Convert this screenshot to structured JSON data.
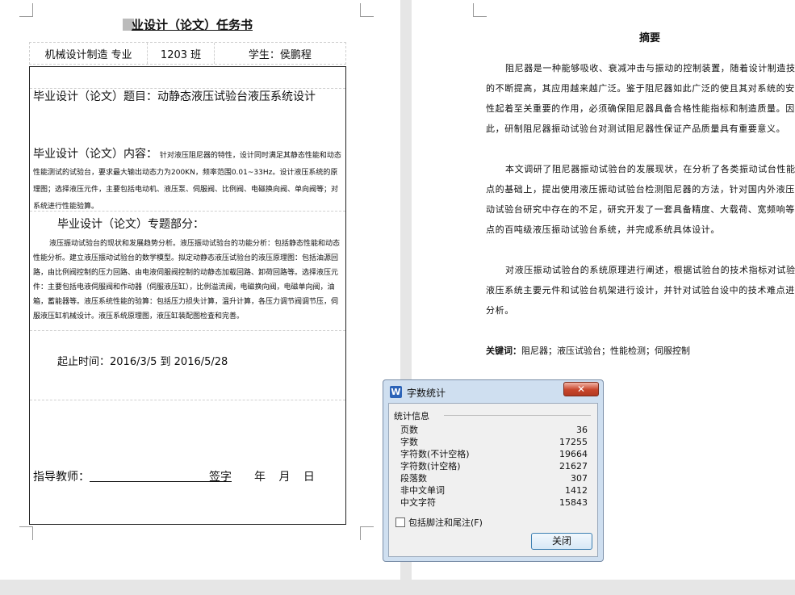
{
  "task_page": {
    "title": "业设计（论文）任务书",
    "major": "机械设计制造 专业",
    "class": "1203 班",
    "student": "学生：侯鹏程",
    "topic_label": "毕业设计（论文）题目：",
    "topic_value": "动静态液压试验台液压系统设计",
    "content_label": "毕业设计（论文）内容：",
    "content_text": "针对液压阻尼器的特性，设计同时满足其静态性能和动态性能测试的试验台，要求最大输出动态力为200KN，频率范围0.01~33Hz。设计液压系统的原理图；选择液压元件，主要包括电动机、液压泵、伺服阀、比例阀、电磁换向阀、单向阀等；对系统进行性能验算。",
    "special_label": "毕业设计（论文）专题部分：",
    "special_text": "液压振动试验台的现状和发展趋势分析。液压振动试验台的功能分析：包括静态性能和动态性能分析。建立液压振动试验台的数学模型。拟定动静态液压试验台的液压原理图：包括油源回路，由比例阀控制的压力回路、由电液伺服阀控制的动静态加载回路、卸荷回路等。选择液压元件：主要包括电液伺服阀和作动器（伺服液压缸），比例溢流阀，电磁换向阀，电磁单向阀，油箱，蓄能器等。液压系统性能的验算：包括压力损失计算，温升计算，各压力调节阀调节压，伺服液压缸机械设计。液压系统原理图，液压缸装配图检查和完善。",
    "period_label": "起止时间：",
    "period_value": "2016/3/5 到 2016/5/28",
    "teacher_label": "指导教师：",
    "sign_label": "签字",
    "date_label": "年 月 日"
  },
  "abstract_page": {
    "title": "摘要",
    "paragraphs": [
      "阻尼器是一种能够吸收、衰减冲击与振动的控制装置，随着设计制造技术的不断提高，其应用越来越广泛。鉴于阻尼器如此广泛的使且其对系统的安全性起着至关重要的作用，必须确保阻尼器具备合格性能指标和制造质量。因此，研制阻尼器振动试验台对测试阻尼器性保证产品质量具有重要意义。",
      "本文调研了阻尼器振动试验台的发展现状，在分析了各类振动试台性能特点的基础上，提出使用液压振动试验台检测阻尼器的方法，针对国内外液压振动试验台研究中存在的不足，研究开发了一套具备精度、大载荷、宽频响等特点的百吨级液压振动试验台系统，并完成系统具体设计。",
      "对液压振动试验台的系统原理进行阐述，根据试验台的技术指标对试验台 液压系统主要元件和试验台机架进行设计，并针对试验台设中的技术难点进行 分析。"
    ],
    "keywords_label": "关键词：",
    "keywords_value": "阻尼器；液压试验台；性能检测；伺服控制"
  },
  "dialog": {
    "app_icon": "W",
    "title": "字数统计",
    "close_glyph": "✕",
    "group_label": "统计信息",
    "stats": [
      {
        "label": "页数",
        "value": "36"
      },
      {
        "label": "字数",
        "value": "17255"
      },
      {
        "label": "字符数(不计空格)",
        "value": "19664"
      },
      {
        "label": "字符数(计空格)",
        "value": "21627"
      },
      {
        "label": "段落数",
        "value": "307"
      },
      {
        "label": "非中文单词",
        "value": "1412"
      },
      {
        "label": "中文字符",
        "value": "15843"
      }
    ],
    "checkbox_label": "包括脚注和尾注(F)",
    "checkbox_checked": false,
    "close_button": "关闭"
  }
}
